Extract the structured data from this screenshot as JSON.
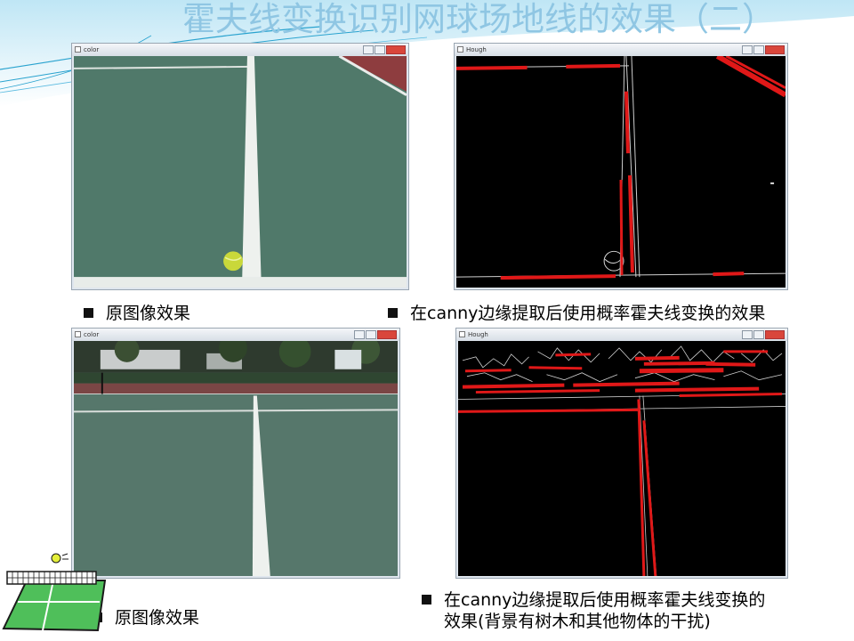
{
  "slide": {
    "title": "霍夫线变换识别网球场地线的效果（二）"
  },
  "windows": [
    {
      "id": "top-left",
      "title": "color"
    },
    {
      "id": "top-right",
      "title": "Hough"
    },
    {
      "id": "bottom-left",
      "title": "color"
    },
    {
      "id": "bottom-right",
      "title": "Hough"
    }
  ],
  "captions": {
    "top_left": "原图像效果",
    "top_right": "在canny边缘提取后使用概率霍夫线变换的效果",
    "bottom_left": "原图像效果",
    "bottom_right_line1": "在canny边缘提取后使用概率霍夫线变换的",
    "bottom_right_line2": "效果(背景有树木和其他物体的干扰)"
  },
  "colors": {
    "title": "#8fc6e3",
    "court_green": "#4f7a63",
    "court_red": "#9a3b3b",
    "hough_line": "#e01818",
    "edge": "#dcdcdc",
    "tennis_ball": "#c9d83a"
  },
  "icons": {
    "decoration": "tennis-court-clipart-icon"
  }
}
